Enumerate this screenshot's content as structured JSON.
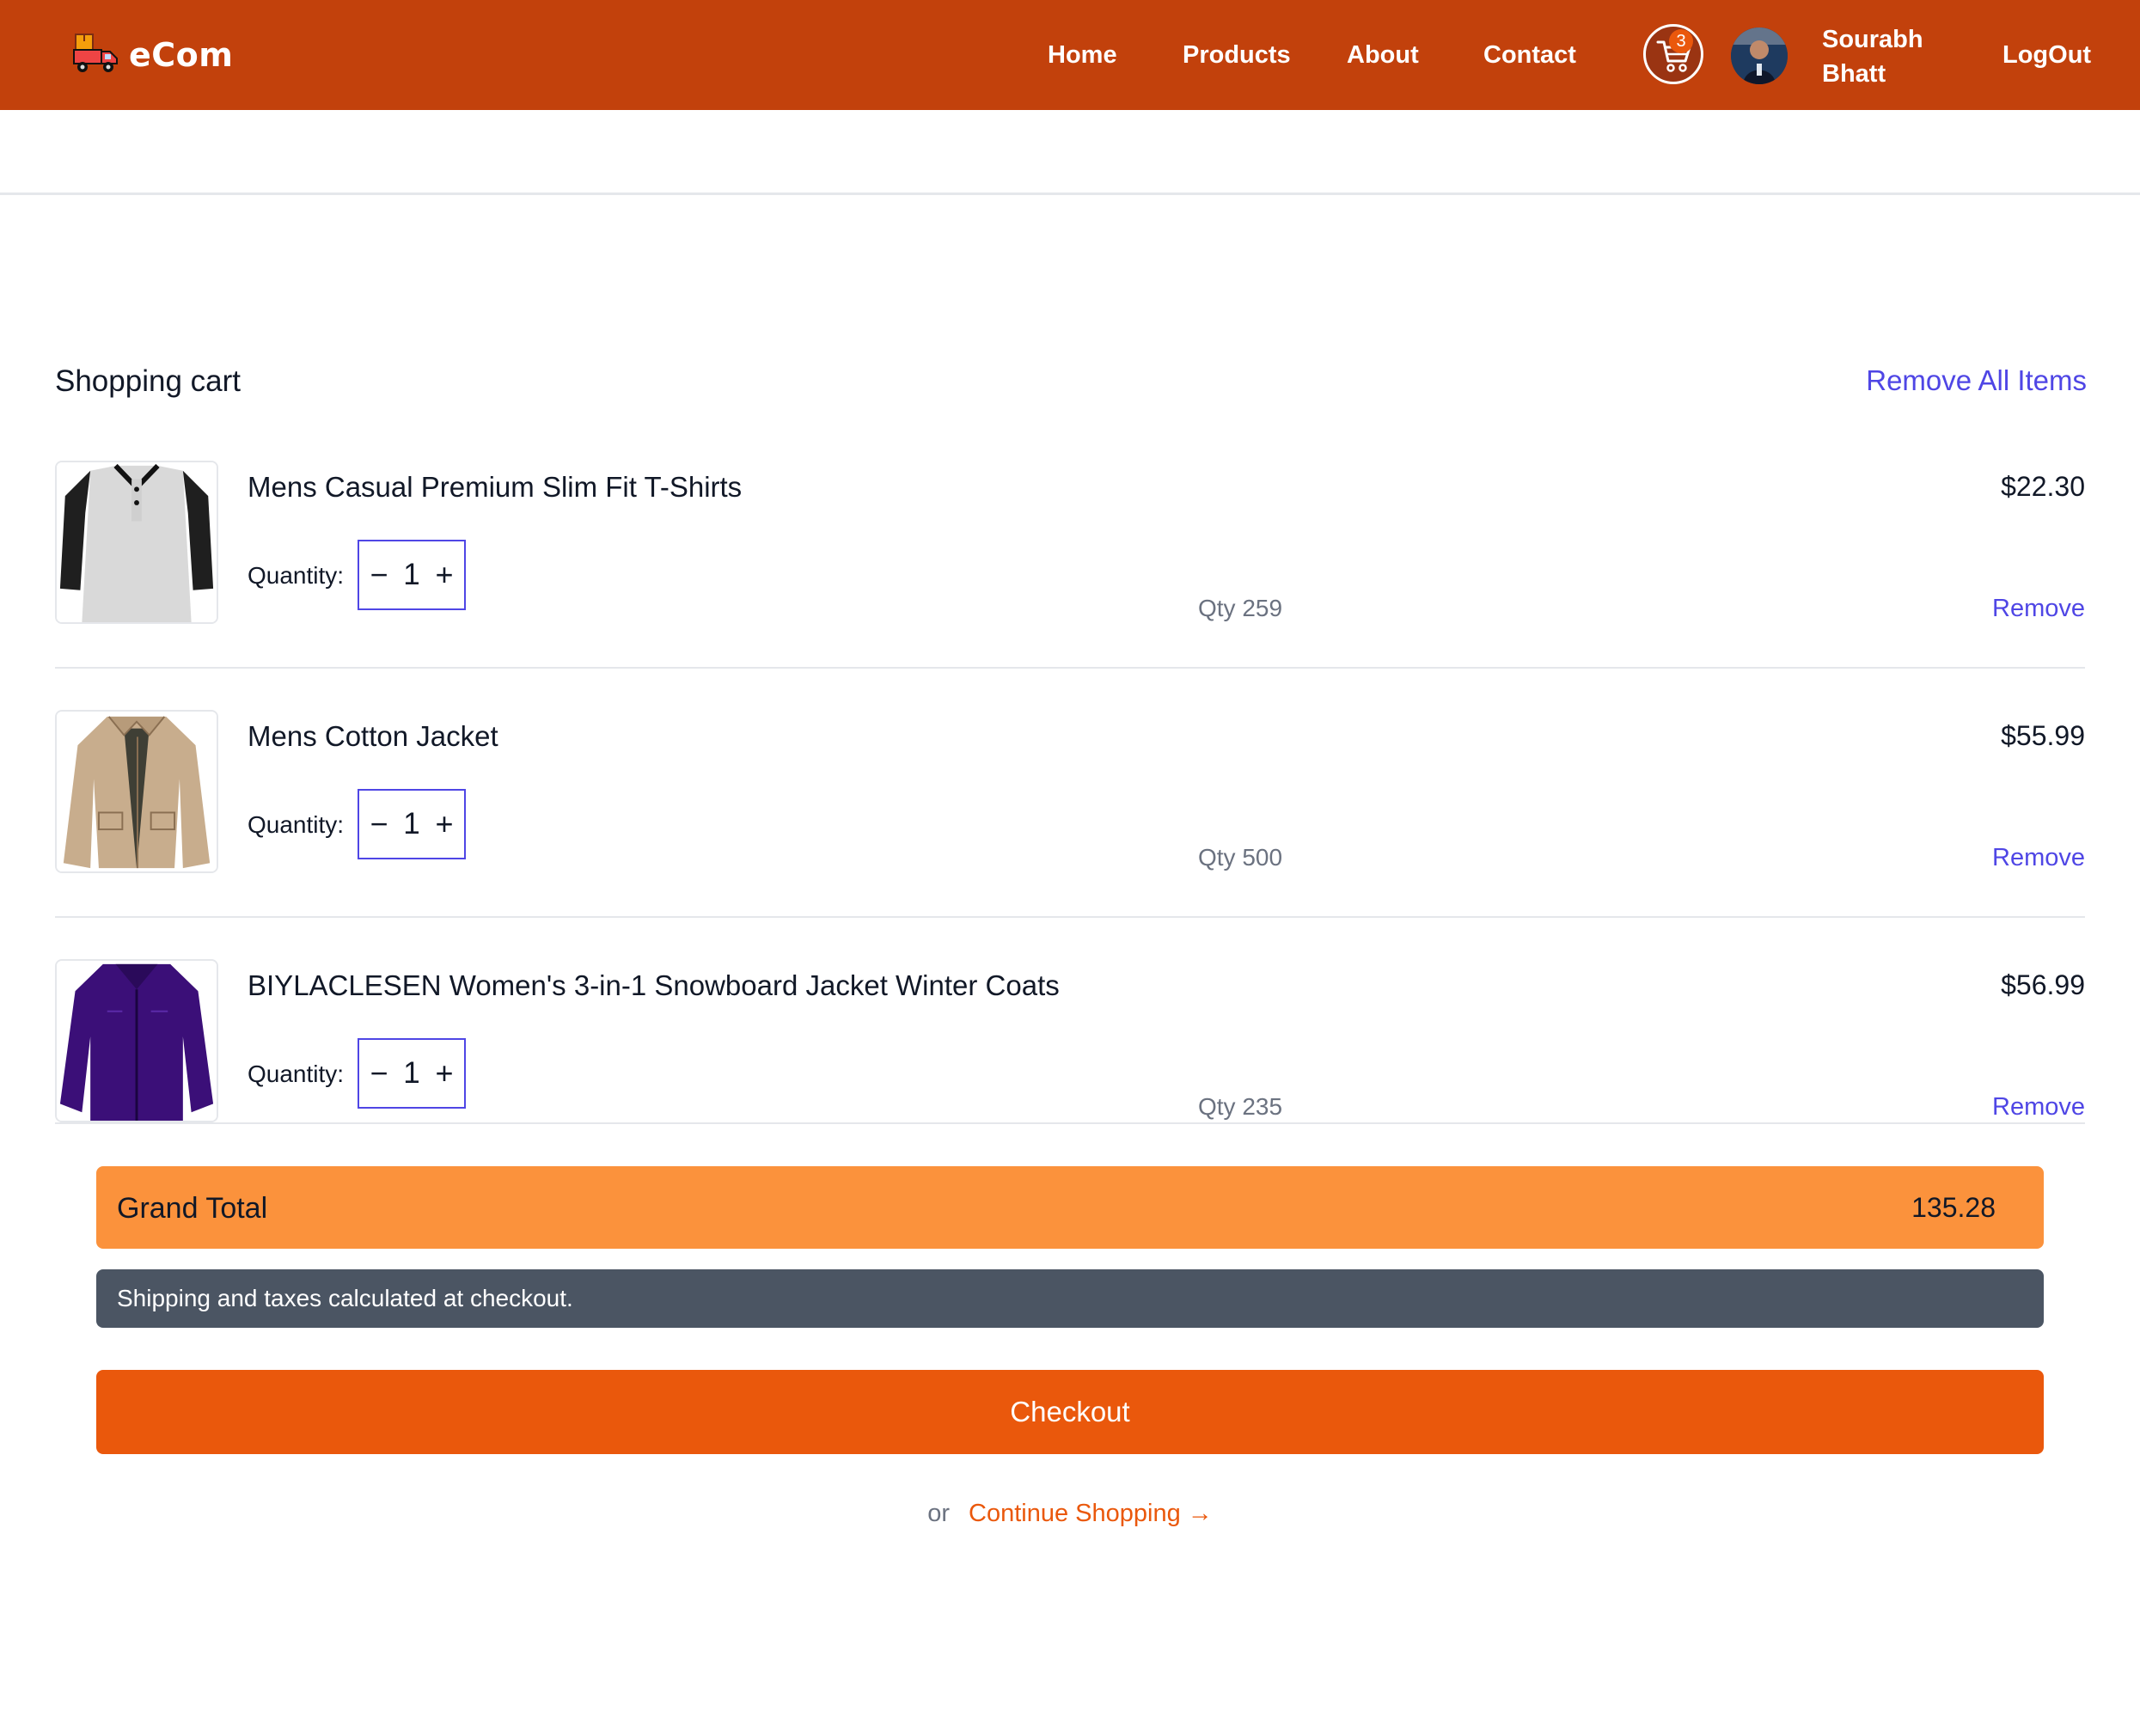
{
  "header": {
    "brand": "eCom",
    "nav": [
      {
        "label": "Home"
      },
      {
        "label": "Products"
      },
      {
        "label": "About"
      },
      {
        "label": "Contact"
      }
    ],
    "cart_count": "3",
    "user_name": "Sourabh Bhatt",
    "logout_label": "LogOut",
    "colors": {
      "bar": "#c2410c",
      "badge": "#ea580c"
    },
    "icons": [
      "delivery-truck-icon",
      "shopping-cart-icon",
      "user-avatar"
    ]
  },
  "cart": {
    "title": "Shopping cart",
    "remove_all_label": "Remove All Items",
    "quantity_label": "Quantity:",
    "remove_label": "Remove",
    "decrement": "−",
    "increment": "+",
    "items": [
      {
        "name": "Mens Casual Premium Slim Fit T-Shirts",
        "price": "$22.30",
        "quantity": "1",
        "stock": "Qty 259",
        "image": "tshirt-image"
      },
      {
        "name": "Mens Cotton Jacket",
        "price": "$55.99",
        "quantity": "1",
        "stock": "Qty 500",
        "image": "jacket-image"
      },
      {
        "name": "BIYLACLESEN Women's 3-in-1 Snowboard Jacket Winter Coats",
        "price": "$56.99",
        "quantity": "1",
        "stock": "Qty 235",
        "image": "winter-coat-image"
      }
    ]
  },
  "summary": {
    "grand_total_label": "Grand Total",
    "grand_total_value": "135.28",
    "shipping_note": "Shipping and taxes calculated at checkout.",
    "checkout_label": "Checkout",
    "or_label": "or",
    "continue_label": "Continue Shopping →",
    "colors": {
      "total_bar": "#fb923c",
      "note_bar": "#4b5563",
      "checkout": "#ea580c",
      "link": "#4f46e5"
    }
  }
}
